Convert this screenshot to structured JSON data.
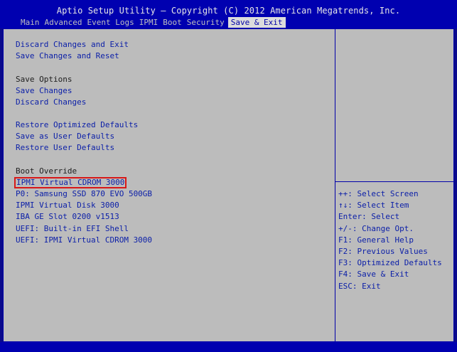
{
  "header": {
    "title": "Aptio Setup Utility – Copyright (C) 2012 American Megatrends, Inc.",
    "tabs": [
      "Main",
      "Advanced",
      "Event Logs",
      "IPMI",
      "Boot",
      "Security",
      "Save & Exit"
    ],
    "active_tab": "Save & Exit"
  },
  "menu": {
    "discard_exit": "Discard Changes and Exit",
    "save_reset": "Save Changes and Reset",
    "save_options_heading": "Save Options",
    "save_changes": "Save Changes",
    "discard_changes": "Discard Changes",
    "restore_optimized": "Restore Optimized Defaults",
    "save_user_defaults": "Save as User Defaults",
    "restore_user_defaults": "Restore User Defaults",
    "boot_override_heading": "Boot Override",
    "boot_items": [
      "IPMI Virtual CDROM 3000",
      "P0: Samsung SSD 870 EVO 500GB",
      "IPMI Virtual Disk 3000",
      "IBA GE Slot 0200 v1513",
      "UEFI: Built-in EFI Shell",
      "UEFI: IPMI Virtual CDROM 3000"
    ]
  },
  "help": [
    "++: Select Screen",
    "↑↓: Select Item",
    "Enter: Select",
    "+/-: Change Opt.",
    "F1: General Help",
    "F2: Previous Values",
    "F3: Optimized Defaults",
    "F4: Save & Exit",
    "ESC: Exit"
  ],
  "colors": {
    "background": "#0a0a8c",
    "panel": "#bcbcbc",
    "link_text": "#0a1ea8",
    "selection_border": "#d81818"
  }
}
